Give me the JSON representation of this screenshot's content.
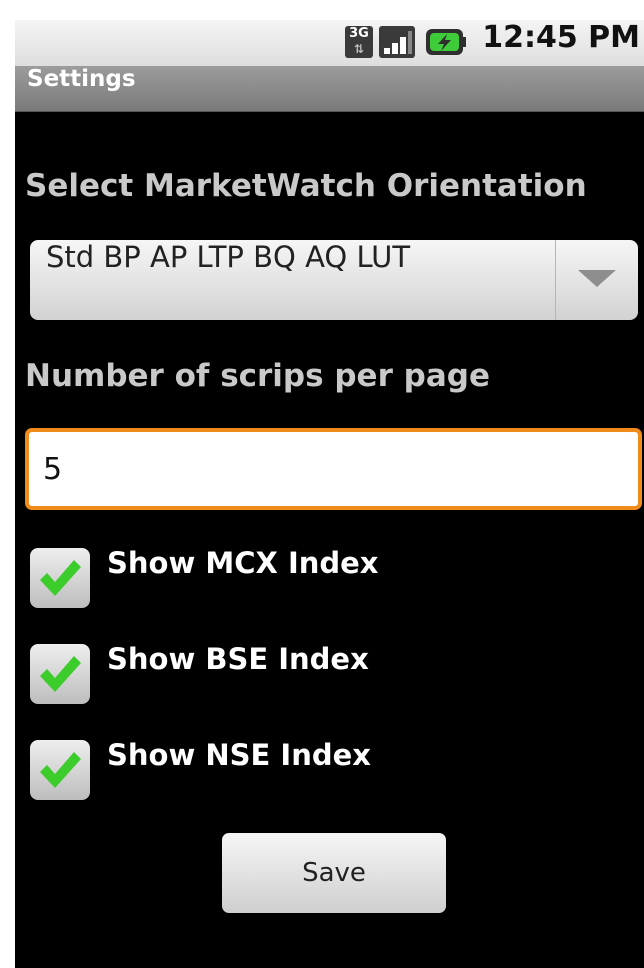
{
  "status_bar": {
    "network_type": "3G",
    "data_activity_glyph": "⇅",
    "signal_icon": "signal-strength-icon",
    "battery_icon": "battery-charging-icon",
    "time": "12:45 PM"
  },
  "title_bar": {
    "title": "Settings"
  },
  "orientation": {
    "label": "Select MarketWatch Orientation",
    "selected": "Std BP AP LTP BQ AQ LUT"
  },
  "scrips": {
    "label": "Number of scrips per page",
    "value": "5",
    "focused": true
  },
  "checkboxes": [
    {
      "label": "Show MCX Index",
      "checked": true
    },
    {
      "label": "Show BSE Index",
      "checked": true
    },
    {
      "label": "Show NSE Index",
      "checked": true
    }
  ],
  "save_button": {
    "label": "Save"
  },
  "colors": {
    "focus_border": "#f08c1a",
    "checkmark": "#3ccc2c",
    "background": "#000000"
  }
}
